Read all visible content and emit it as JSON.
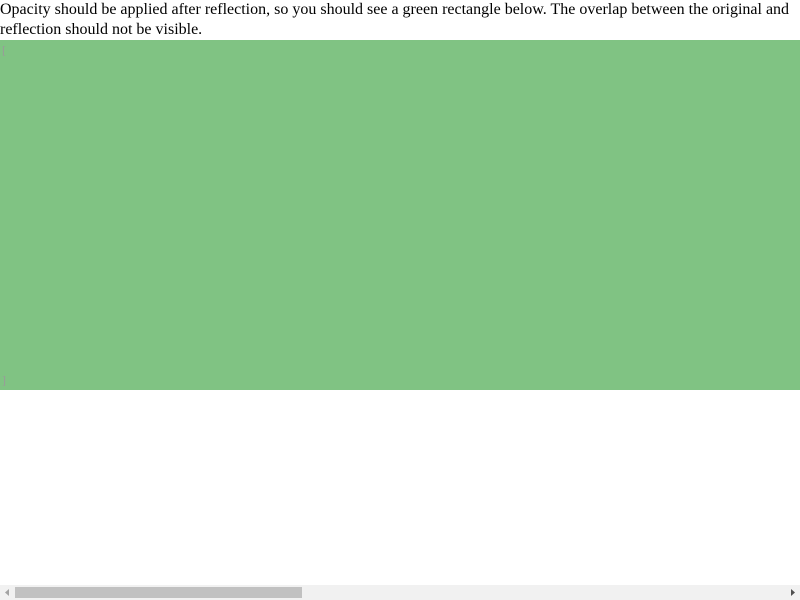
{
  "description": {
    "text": "Opacity should be applied after reflection, so you should see a green rectangle below. The overlap between the original and reflection should not be visible."
  },
  "test_area": {
    "fill_color": "#80c383",
    "marker_top": "[",
    "marker_bottom": "]"
  },
  "scrollbar": {
    "left_arrow_icon": "triangle-left",
    "right_arrow_icon": "triangle-right",
    "thumb_fraction": 0.36
  }
}
